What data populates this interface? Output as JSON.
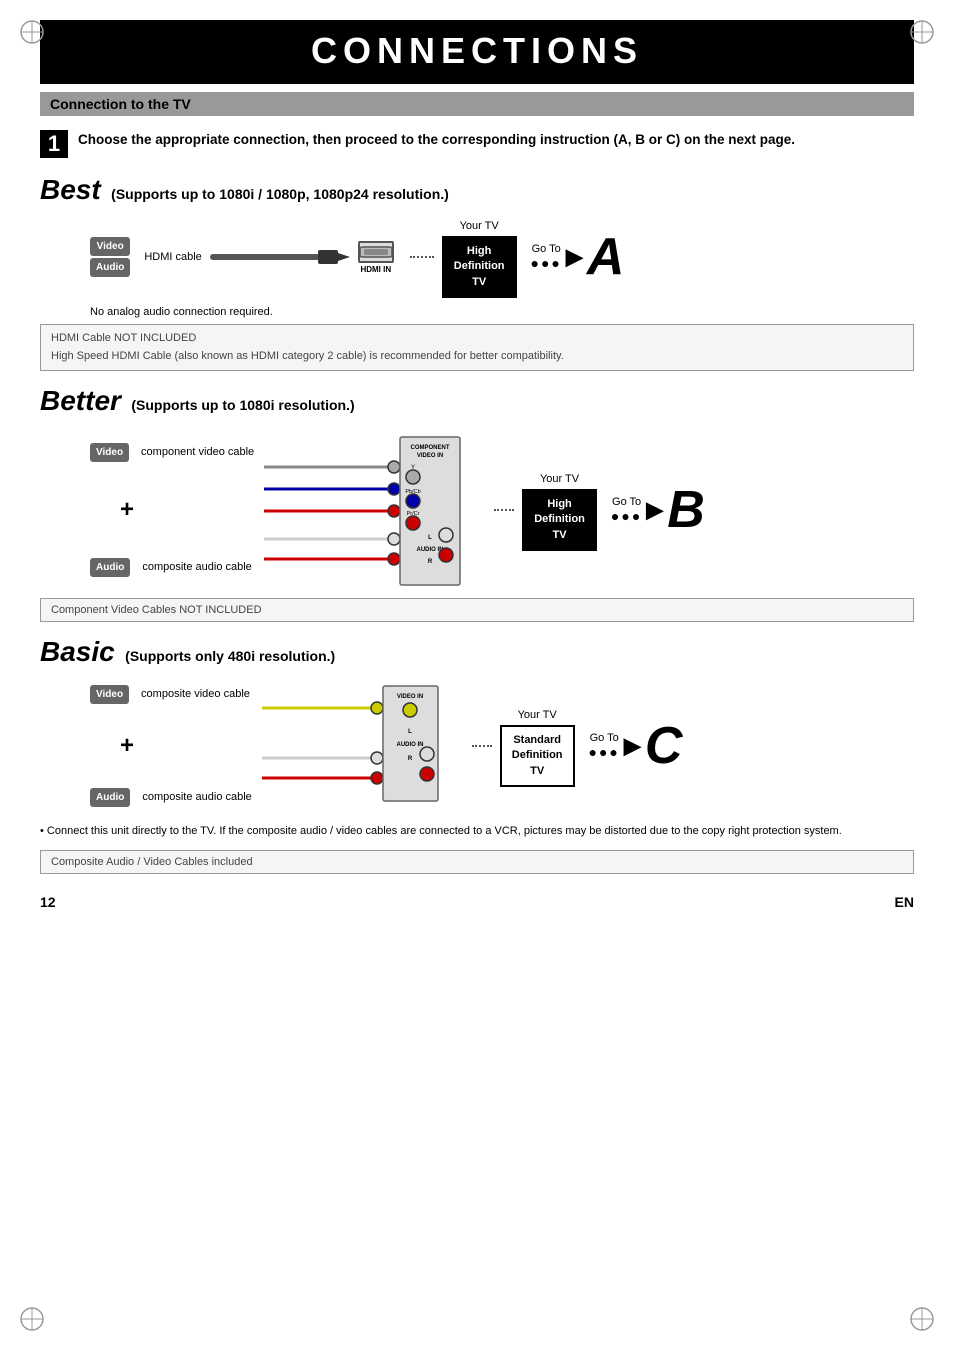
{
  "page": {
    "title": "CONNECTIONS",
    "number": "12",
    "lang": "EN",
    "section_title": "Connection to the TV"
  },
  "step1": {
    "number": "1",
    "text": "Choose the appropriate connection, then proceed to the corresponding instruction (A, B or C) on the next page."
  },
  "best": {
    "heading": "Best",
    "sub": "(Supports up to 1080i / 1080p, 1080p24 resolution.)",
    "video_badge": "Video",
    "audio_badge": "Audio",
    "cable_label": "HDMI cable",
    "hdmi_port_label": "HDMI IN",
    "your_tv": "Your TV",
    "tv_label_line1": "High",
    "tv_label_line2": "Definition",
    "tv_label_line3": "TV",
    "go_to": "Go To",
    "dots": "● ● ●",
    "letter": "A",
    "note_line1": "No analog audio connection required.",
    "note_box": "HDMI Cable NOT INCLUDED\nHigh Speed HDMI Cable (also known as HDMI category 2 cable) is recommended for better compatibility."
  },
  "better": {
    "heading": "Better",
    "sub": "(Supports up to 1080i resolution.)",
    "video_badge": "Video",
    "audio_badge": "Audio",
    "video_cable": "component video cable",
    "audio_cable": "composite audio cable",
    "comp_label": "COMPONENT\nVIDEO IN",
    "pb_label": "Pb/Cb",
    "pr_label": "Pr/Cr",
    "audio_in_label": "AUDIO IN",
    "your_tv": "Your TV",
    "tv_label_line1": "High",
    "tv_label_line2": "Definition",
    "tv_label_line3": "TV",
    "go_to": "Go To",
    "dots": "● ● ●",
    "letter": "B",
    "note_box": "Component Video Cables NOT INCLUDED"
  },
  "basic": {
    "heading": "Basic",
    "sub": "(Supports only 480i resolution.)",
    "video_badge": "Video",
    "audio_badge": "Audio",
    "video_cable": "composite video cable",
    "audio_cable": "composite audio cable",
    "video_in_label": "VIDEO IN",
    "audio_in_label": "AUDIO IN",
    "your_tv": "Your TV",
    "tv_label_line1": "Standard",
    "tv_label_line2": "Definition",
    "tv_label_line3": "TV",
    "go_to": "Go To",
    "dots": "● ● ●",
    "letter": "C",
    "bullet_note": "• Connect this unit directly to the TV. If the composite audio / video cables are connected to a VCR, pictures may be distorted due to the copy right protection system.",
    "note_box": "Composite Audio / Video Cables included"
  }
}
